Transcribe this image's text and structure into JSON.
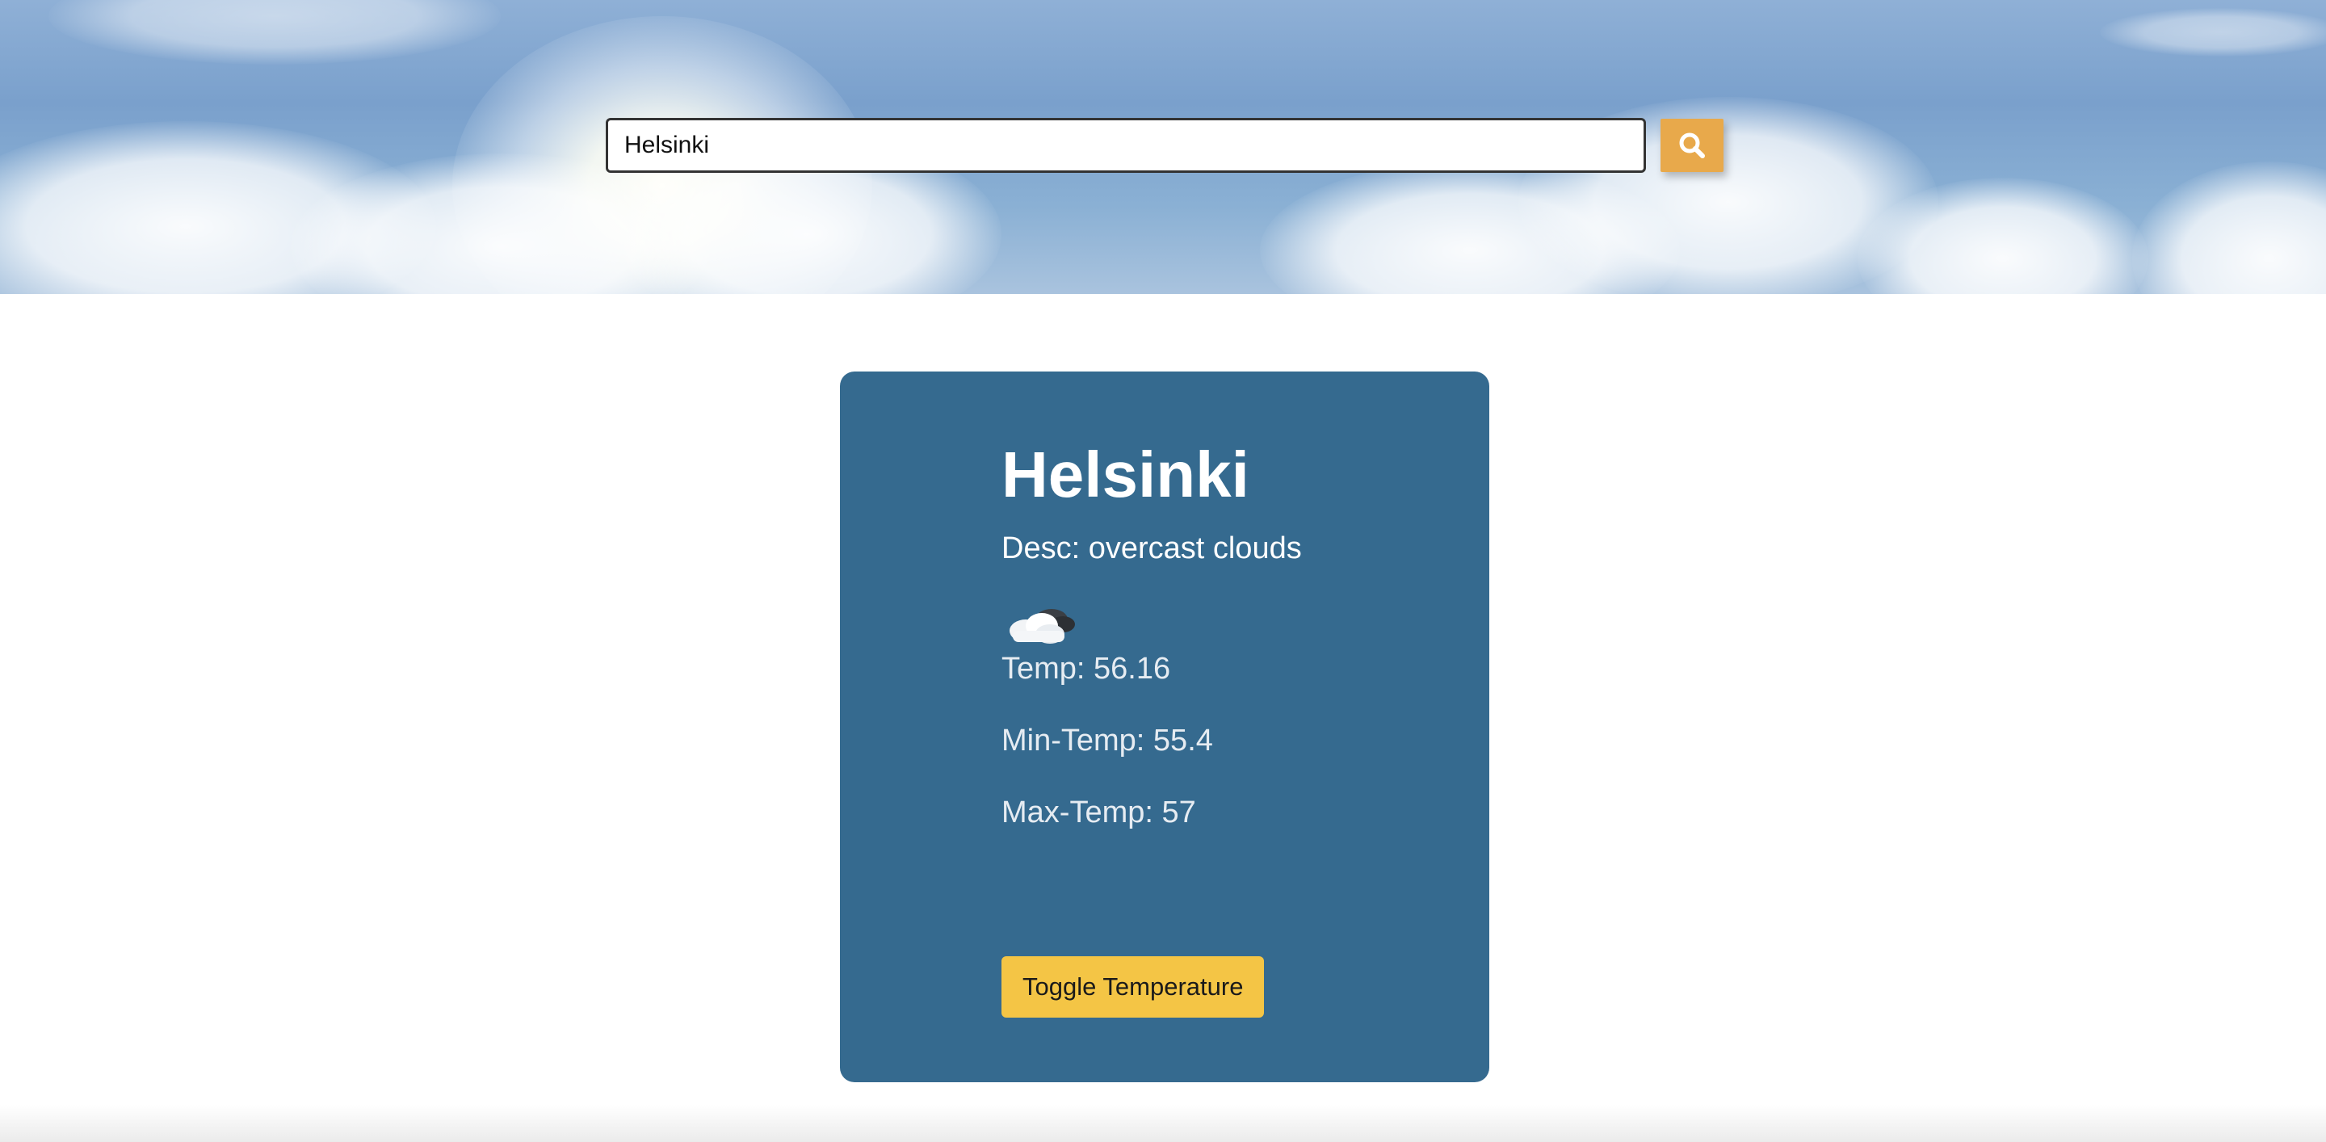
{
  "search": {
    "value": "Helsinki",
    "button_icon": "search-icon"
  },
  "weather": {
    "city": "Helsinki",
    "description": "Desc: overcast clouds",
    "icon": "overcast-clouds-icon",
    "temp": "Temp: 56.16",
    "min_temp": "Min-Temp: 55.4",
    "max_temp": "Max-Temp: 57"
  },
  "actions": {
    "toggle_label": "Toggle Temperature"
  },
  "colors": {
    "card_background": "#356a8f",
    "search_button": "#e8a94b",
    "toggle_button": "#f4c545"
  }
}
